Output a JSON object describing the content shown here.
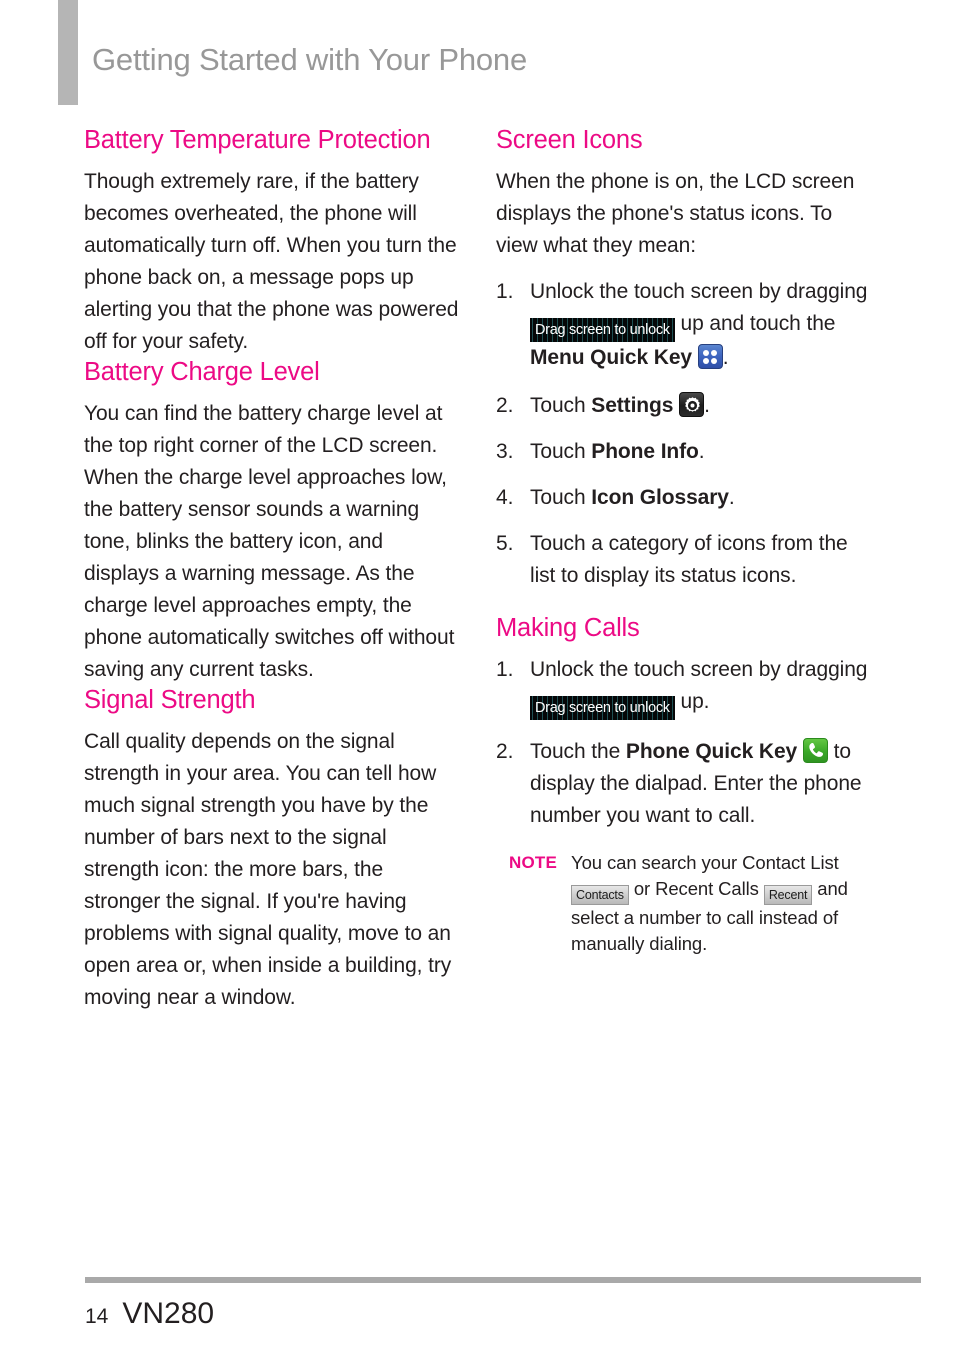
{
  "header": {
    "title": "Getting Started with Your Phone",
    "accent_bar_color": "#b5b5b5",
    "title_color": "#989898"
  },
  "colors": {
    "heading_pink": "#ec0a85",
    "body_text": "#231f20",
    "rule_gray": "#a9a9a9"
  },
  "left_column": {
    "sections": [
      {
        "heading": "Battery Temperature Protection",
        "body": "Though extremely rare, if the battery becomes overheated, the phone will automatically turn off. When you turn the phone back on, a message pops up alerting you that the phone was powered off for your safety."
      },
      {
        "heading": "Battery Charge Level",
        "body": "You can find the battery charge level at the top right corner of the LCD screen. When the charge level approaches low, the battery sensor sounds a warning tone, blinks the battery icon, and displays a warning message. As the charge level approaches empty, the phone automatically switches off without saving any current tasks."
      },
      {
        "heading": "Signal Strength",
        "body": "Call quality depends on the signal strength in your area. You can tell how much signal strength you have by the number of bars next to the signal strength icon: the more bars, the stronger the signal. If you're having problems with signal quality, move to an open area or, when inside a building, try moving near a window."
      }
    ]
  },
  "right_column": {
    "screen_icons": {
      "heading": "Screen Icons",
      "body": "When the phone is on, the LCD screen displays the phone's status icons. To view what they mean:",
      "steps": {
        "step1_a": "Unlock the touch screen by dragging",
        "step1_chip": "Drag screen to unlock",
        "step1_b": "up and touch the",
        "step1_bold": "Menu Quick Key",
        "step1_c": ".",
        "step2_a": "Touch",
        "step2_bold": "Settings",
        "step2_c": ".",
        "step3_a": "Touch",
        "step3_bold": "Phone Info",
        "step3_c": ".",
        "step4_a": "Touch",
        "step4_bold": "Icon Glossary",
        "step4_c": ".",
        "step5": "Touch a category of icons from the list to display its status icons."
      }
    },
    "making_calls": {
      "heading": "Making Calls",
      "steps": {
        "step1_a": "Unlock the touch screen by dragging",
        "step1_chip": "Drag screen to unlock",
        "step1_b": "up.",
        "step2_a": "Touch the",
        "step2_bold": "Phone Quick Key",
        "step2_b": "to display the dialpad. Enter the phone number you want to call."
      },
      "note": {
        "label": "NOTE",
        "text_a": "You can search your Contact List",
        "badge_contacts": "Contacts",
        "text_b": "or Recent Calls",
        "badge_recent": "Recent",
        "text_c": "and select a number to call instead of manually dialing."
      }
    }
  },
  "footer": {
    "page_number": "14",
    "model": "VN280"
  }
}
